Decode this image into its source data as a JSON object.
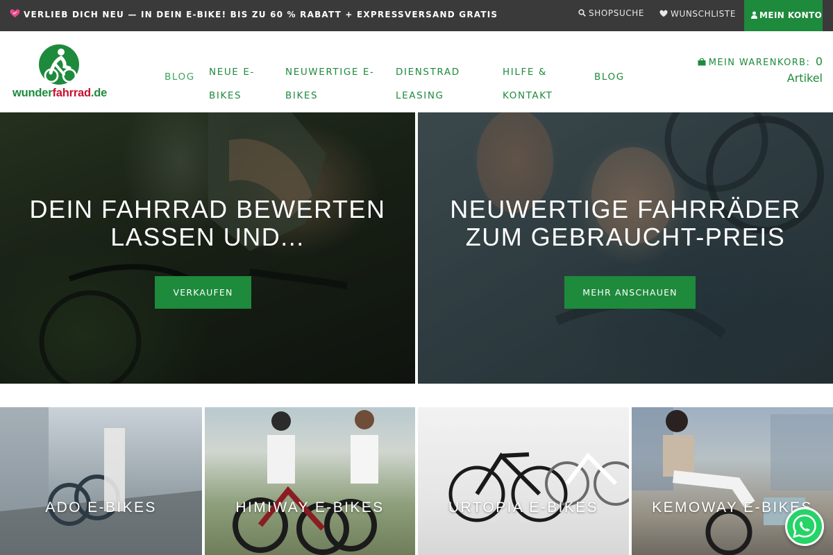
{
  "topbar": {
    "promo_text": "VERLIEB DICH NEU — IN DEIN E-BIKE! BIS ZU 60 % RABATT + EXPRESSVERSAND GRATIS",
    "search_label": "SHOPSUCHE",
    "wishlist_label": "WUNSCHLISTE",
    "account_label": "MEIN KONTO"
  },
  "logo": {
    "part1": "wunder",
    "part2": "fahrrad",
    "part3": ".de"
  },
  "nav": {
    "items": [
      {
        "label": "BLOG"
      },
      {
        "label": "NEUE E-BIKES"
      },
      {
        "label": "NEUWERTIGE E-BIKES"
      },
      {
        "label": "DIENSTRAD LEASING"
      },
      {
        "label": "HILFE & KONTAKT"
      },
      {
        "label": "BLOG"
      }
    ]
  },
  "cart": {
    "label": "MEIN WARENKORB:",
    "count": "0",
    "unit": "Artikel"
  },
  "hero": {
    "left": {
      "title": "DEIN FAHRRAD BEWERTEN LASSEN UND...",
      "button": "VERKAUFEN"
    },
    "right": {
      "title": "NEUWERTIGE FAHRRÄDER ZUM GEBRAUCHT-PREIS",
      "button": "MEHR ANSCHAUEN"
    }
  },
  "categories": [
    {
      "label": "ADO E-BIKES"
    },
    {
      "label": "HIMIWAY E-BIKES"
    },
    {
      "label": "URTOPIA E-BIKES"
    },
    {
      "label": "KEMOWAY E-BIKES"
    }
  ],
  "colors": {
    "brand_green": "#1e8a3c",
    "topbar": "#3a3a3a",
    "logo_red": "#c8102e"
  },
  "icons": [
    "hearts-icon",
    "search-icon",
    "heart-icon",
    "user-icon",
    "shopping-bag-icon",
    "whatsapp-icon"
  ]
}
